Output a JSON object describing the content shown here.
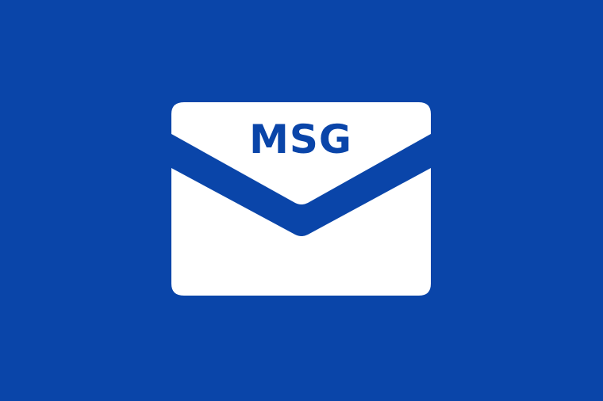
{
  "background_color": "#0a45a9",
  "icon": {
    "name": "envelope-icon",
    "fill_color": "#ffffff",
    "label": "MSG",
    "label_color": "#0a45a9"
  }
}
